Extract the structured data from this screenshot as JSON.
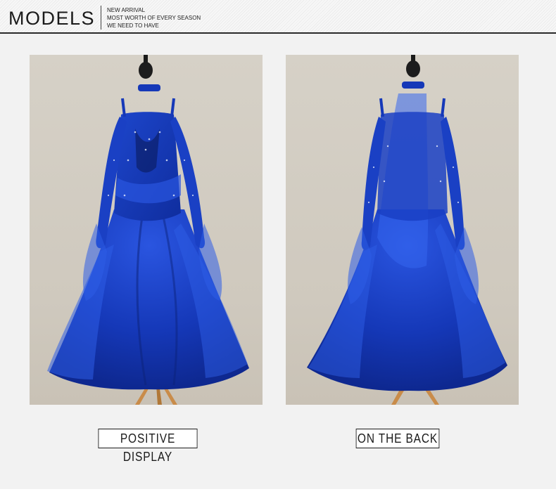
{
  "header": {
    "title": "MODELS",
    "lines": [
      "NEW ARRIVAL",
      "MOST WORTH OF EVERY SEASON",
      "WE NEED TO HAVE"
    ]
  },
  "photos": [
    {
      "caption": "POSITIVE DISPLAY",
      "dress_color": "#1538b8"
    },
    {
      "caption": "ON THE BACK",
      "dress_color": "#1538b8"
    }
  ],
  "colors": {
    "header_bg": "#f2f2f2",
    "dress_blue": "#1538b8",
    "stand_wood": "#c98c4a",
    "backdrop": "#d3cec4"
  }
}
